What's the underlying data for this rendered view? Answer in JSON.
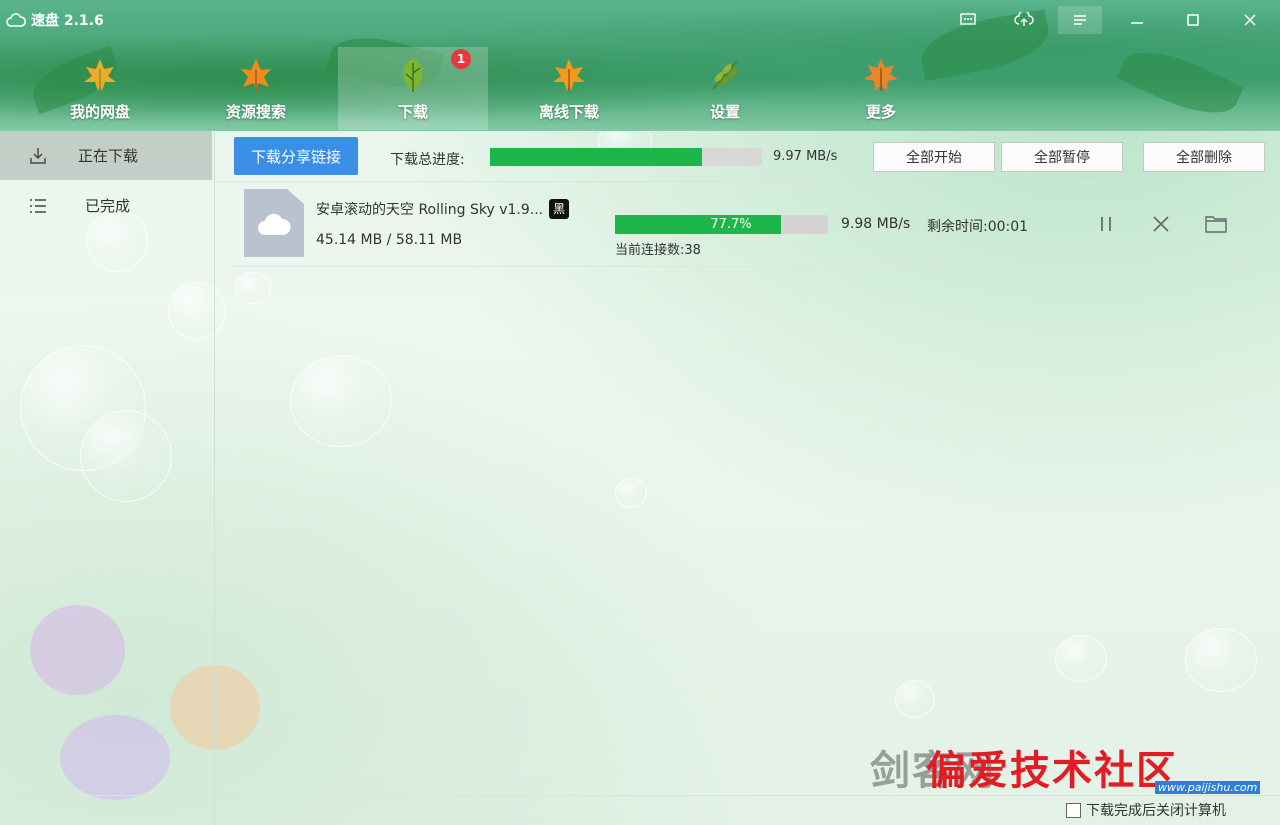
{
  "app": {
    "title": "速盘 2.1.6"
  },
  "window_controls": [
    "message-icon",
    "upload-icon",
    "menu-icon",
    "minimize-icon",
    "maximize-icon",
    "close-icon"
  ],
  "tabs": [
    {
      "label": "我的网盘",
      "icon": "maple-leaf-icon",
      "active": false
    },
    {
      "label": "资源搜索",
      "icon": "orange-leaf-icon",
      "active": false
    },
    {
      "label": "下载",
      "icon": "green-leaf-icon",
      "active": true,
      "badge": "1"
    },
    {
      "label": "离线下载",
      "icon": "maple-leaf-icon",
      "active": false
    },
    {
      "label": "设置",
      "icon": "fern-leaf-icon",
      "active": false
    },
    {
      "label": "更多",
      "icon": "autumn-leaf-icon",
      "active": false
    }
  ],
  "sidebar": {
    "items": [
      {
        "label": "正在下载",
        "icon": "download-tray-icon",
        "active": true
      },
      {
        "label": "已完成",
        "icon": "list-icon",
        "active": false
      }
    ]
  },
  "toolbar": {
    "share_link_button": "下载分享链接",
    "total_progress_label": "下载总进度:",
    "total_progress": 0.78,
    "total_speed": "9.97 MB/s",
    "start_all": "全部开始",
    "pause_all": "全部暂停",
    "delete_all": "全部删除"
  },
  "downloads": [
    {
      "name": "安卓滚动的天空 Rolling Sky v1.9...",
      "tag": "黑",
      "size": "45.14 MB / 58.11 MB",
      "progress": 0.777,
      "progress_text": "77.7%",
      "speed": "9.98 MB/s",
      "remaining": "剩余时间:00:01",
      "connections": "当前连接数:38"
    }
  ],
  "watermark": {
    "text_grey": "剑客网",
    "text_red": "偏爱技术社区",
    "url": "www.paijishu.com"
  },
  "footer": {
    "shutdown_checkbox_label": "下载完成后关闭计算机",
    "checked": false
  },
  "colors": {
    "accent_blue": "#3a8ee6",
    "progress_green": "#1db64b",
    "badge_red": "#e8383d"
  }
}
